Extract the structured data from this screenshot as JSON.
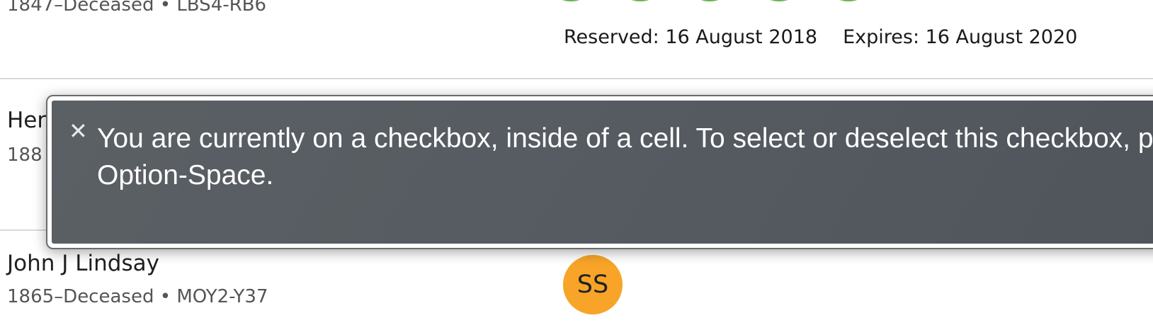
{
  "rows": [
    {
      "meta": "1847–Deceased • LBS4-RB6",
      "reserved": "Reserved: 16 August 2018",
      "expires": "Expires: 16 August 2020",
      "status_color": "#66b84a"
    },
    {
      "name": "Her",
      "meta": "188"
    },
    {
      "name": "John J Lindsay",
      "meta": "1865–Deceased • MOY2-Y37",
      "avatar_initials": "SS",
      "avatar_color": "#f7a428"
    }
  ],
  "voiceover": {
    "close_icon": "close-icon",
    "message": "You are currently on a checkbox, inside of a cell. To select or deselect this checkbox, press Control-Option-Space."
  }
}
